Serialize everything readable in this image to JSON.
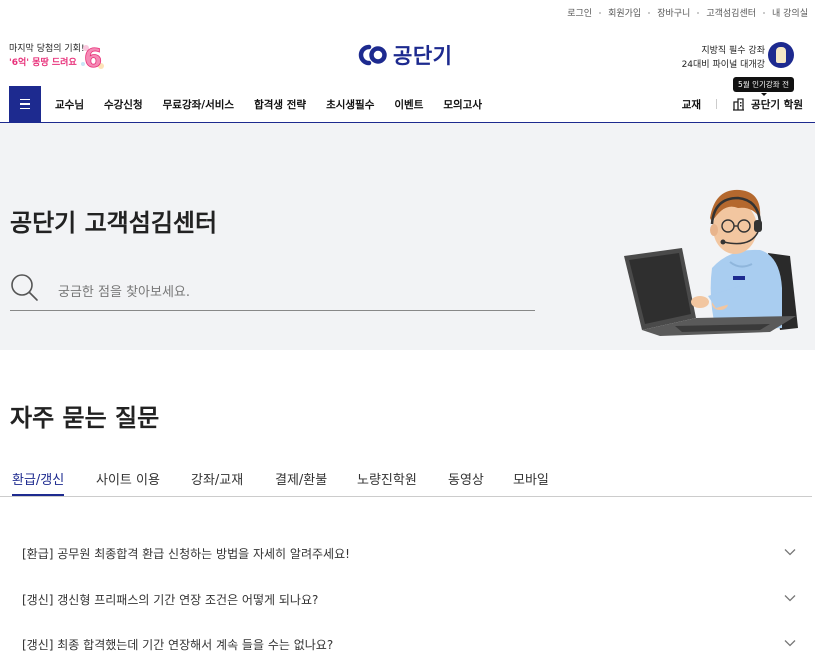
{
  "util": {
    "links": [
      "로그인",
      "회원가입",
      "장바구니",
      "고객섬김센터",
      "내 강의실"
    ]
  },
  "promo_left": {
    "line1": "마지막 당첨의 기회!",
    "line2": "'6억' 몽땅 드려요",
    "badge": "6"
  },
  "logo": {
    "text": "공단기",
    "color": "#1d2a8f"
  },
  "promo_right": {
    "line1": "지방직 필수 강좌",
    "line2": "24대비 파이널 대개강"
  },
  "gnb": {
    "items": [
      "교수님",
      "수강신청",
      "무료강좌/서비스",
      "합격생 전략",
      "초시생필수",
      "이벤트",
      "모의고사"
    ],
    "book": "교재",
    "academy": "공단기 학원",
    "tooltip": "5월 인기강좌 전"
  },
  "hero": {
    "title": "공단기 고객섬김센터",
    "search_placeholder": "궁금한 점을 찾아보세요.",
    "search_value": ""
  },
  "faq": {
    "title": "자주 묻는 질문",
    "tabs": [
      "환급/갱신",
      "사이트 이용",
      "강좌/교재",
      "결제/환불",
      "노량진학원",
      "동영상",
      "모바일"
    ],
    "active_tab": "환급/갱신",
    "items": [
      "[환급] 공무원 최종합격 환급 신청하는 방법을 자세히 알려주세요!",
      "[갱신] 갱신형 프리패스의 기간 연장 조건은 어떻게 되나요?",
      "[갱신] 최종 합격했는데 기간 연장해서 계속 들을 수는 없나요?"
    ]
  },
  "colors": {
    "brand": "#1d2a8f",
    "accent_pink": "#e8307a",
    "hero_bg": "#f2f3f5"
  }
}
